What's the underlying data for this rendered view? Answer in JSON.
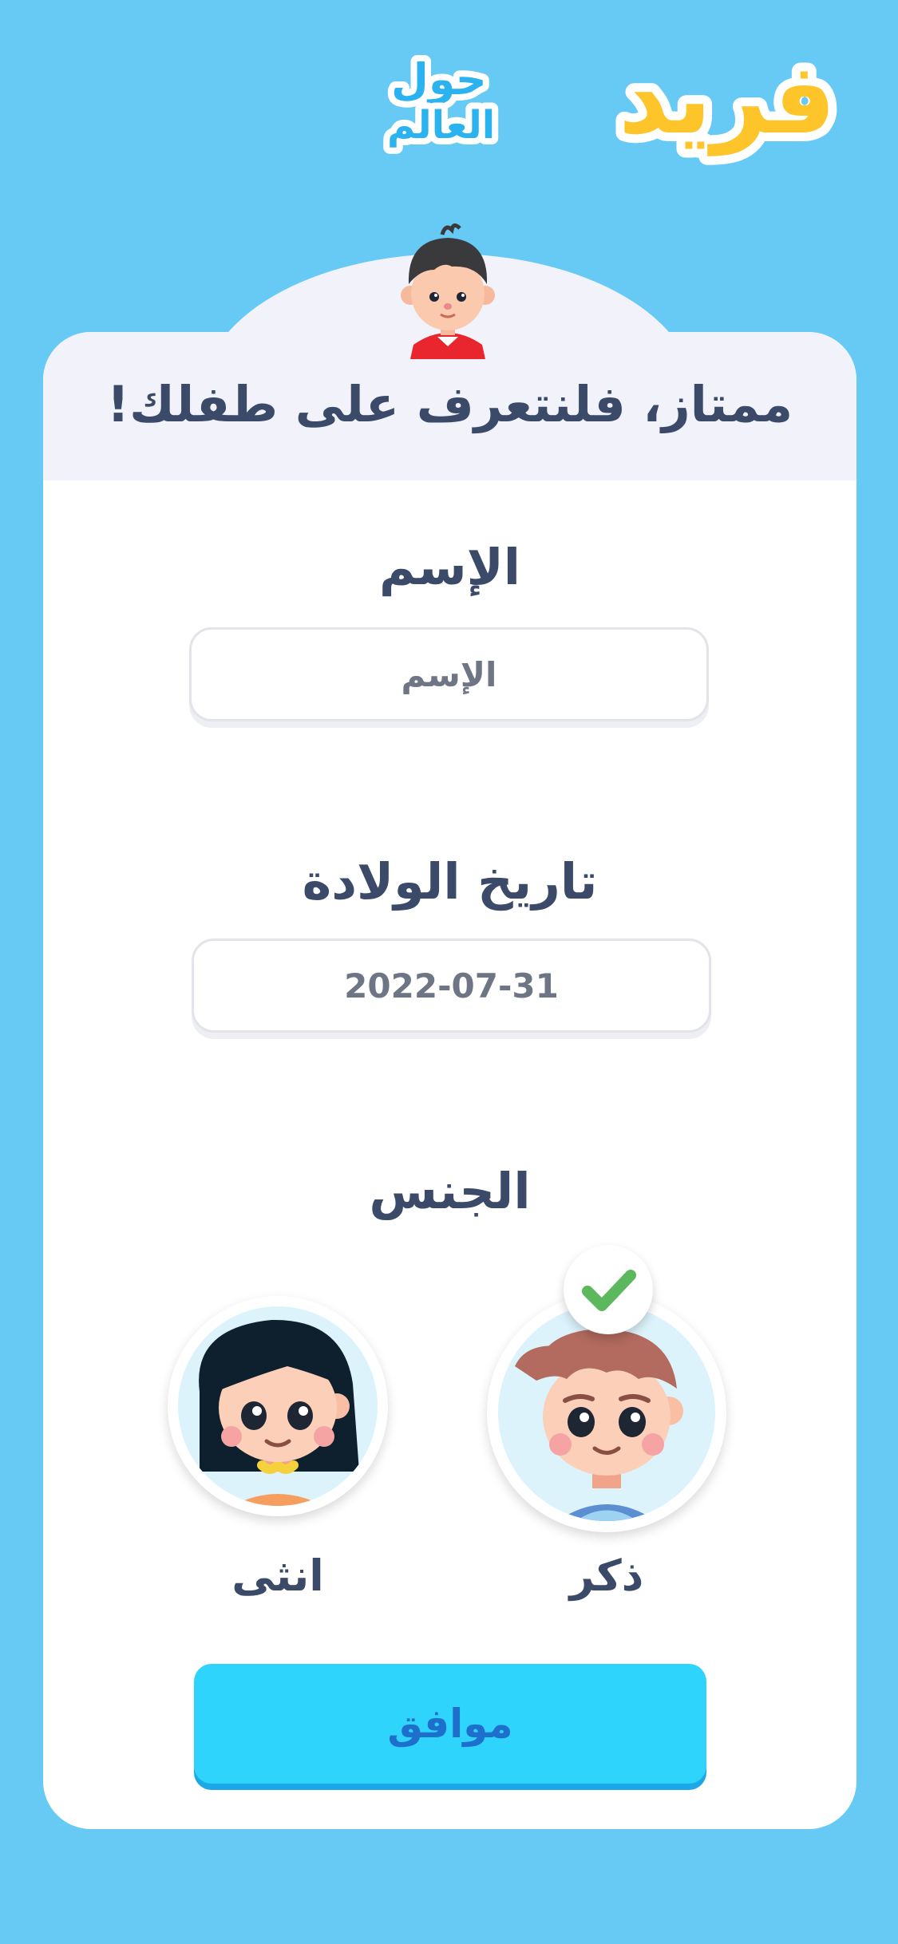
{
  "logo": {
    "main_text": "فريد",
    "line1": "حول",
    "line2": "العالم",
    "colors": {
      "main": "#FDC52A",
      "secondary": "#2BB3F0",
      "outline": "#FFFFFF"
    }
  },
  "card": {
    "heading": "ممتاز، فلنتعرف على طفلك!",
    "header_avatar": "boy-avatar-icon"
  },
  "form": {
    "name": {
      "label": "الإسم",
      "placeholder": "الإسم",
      "value": ""
    },
    "birthdate": {
      "label": "تاريخ الولادة",
      "value": "2022-07-31"
    },
    "gender": {
      "label": "الجنس",
      "options": [
        {
          "label": "ذكر",
          "icon": "boy-avatar-icon",
          "selected": true
        },
        {
          "label": "انثى",
          "icon": "girl-avatar-icon",
          "selected": false
        }
      ]
    }
  },
  "actions": {
    "submit_label": "موافق"
  },
  "colors": {
    "background": "#66CAF4",
    "card": "#FFFFFF",
    "card_header": "#F1F2FA",
    "text": "#3A4A68",
    "button": "#2FD4FC",
    "button_text": "#1E6FCB",
    "check": "#5CB85C"
  }
}
